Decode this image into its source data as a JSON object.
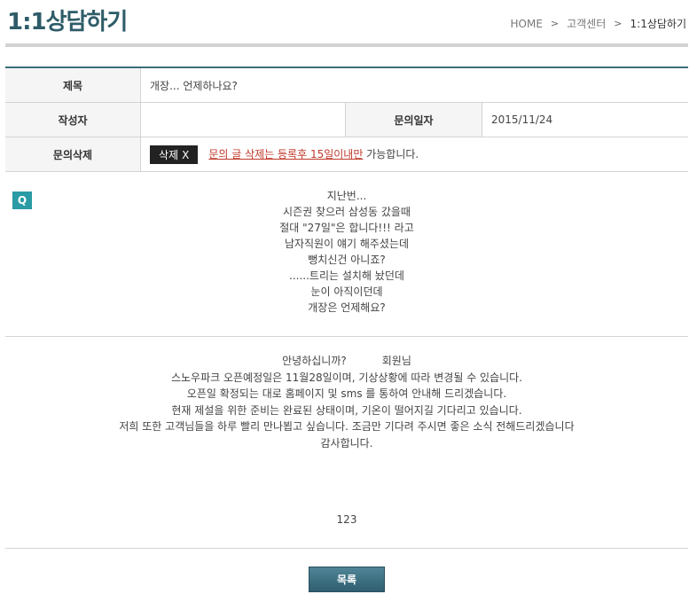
{
  "header": {
    "title": "1:1상담하기",
    "breadcrumb": {
      "home": "HOME",
      "center": "고객센터",
      "current": "1:1상담하기",
      "separator": ">"
    }
  },
  "info": {
    "subject_label": "제목",
    "subject_value": "개장... 언제하나요?",
    "author_label": "작성자",
    "author_value": "",
    "date_label": "문의일자",
    "date_value": "2015/11/24",
    "delete_label": "문의삭제",
    "delete_button": "삭제",
    "delete_button_x": "X",
    "delete_notice_link": "문의 글 삭제는 등록후 15일이내만",
    "delete_notice_suffix": " 가능합니다."
  },
  "question": {
    "badge": "Q",
    "lines": [
      "지난번...",
      "시즌권 찾으러 삼성동 갔을때",
      "절대 \"27일\"은 합니다!!! 라고",
      "남자직원이 얘기 해주셨는데",
      "뻥치신건 아니죠?",
      "......트리는 설치해 놨던데",
      "눈이 아직이던데",
      "개장은 언제해요?"
    ]
  },
  "answer": {
    "greeting": "안녕하십니까?",
    "greeting_suffix": "회원님",
    "lines": [
      "스노우파크 오픈예정일은 11월28일이며, 기상상황에 따라 변경될 수 있습니다.",
      "오픈일 확정되는 대로 홈페이지 및 sms 를 통하여 안내해 드리겠습니다.",
      "현재 제설을 위한 준비는 완료된 상태이며, 기온이 떨어지길 기다리고 있습니다.",
      "저희 또한 고객님들을 하루 빨리 만나뵙고 싶습니다. 조금만 기다려 주시면 좋은 소식 전해드리겠습니다",
      "감사합니다."
    ],
    "signature": "123"
  },
  "footer": {
    "list_button": "목록"
  },
  "colors": {
    "accent": "#2e5c68",
    "badge": "#2a9ba4",
    "warning_link": "#c0392b"
  }
}
